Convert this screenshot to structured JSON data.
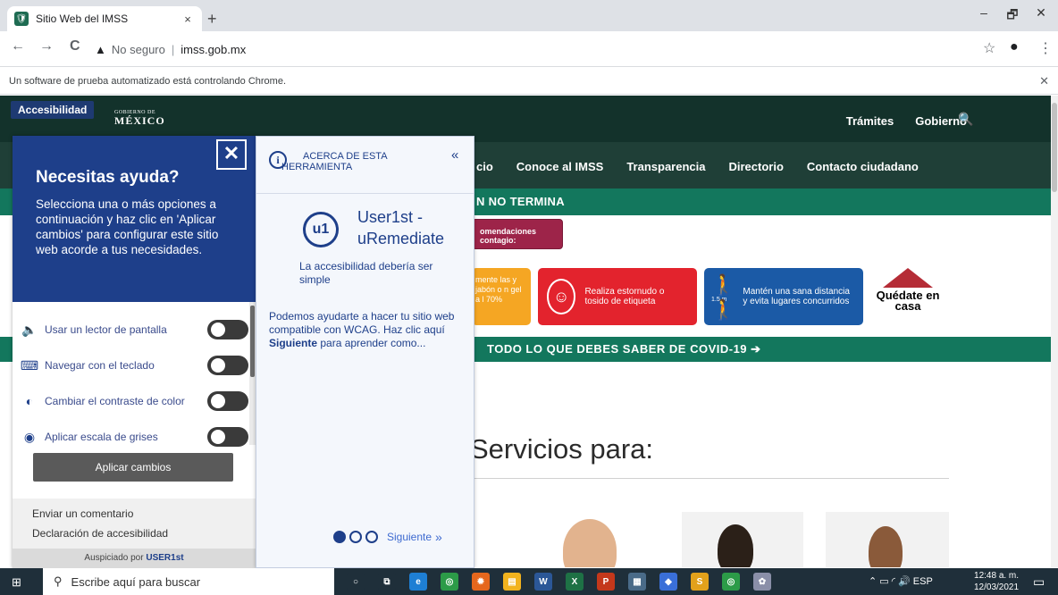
{
  "browser": {
    "tab_title": "Sitio Web del IMSS",
    "tab_close": "×",
    "new_tab": "+",
    "window_min": "–",
    "window_restore": "🗗",
    "window_close": "✕",
    "back": "←",
    "forward": "→",
    "reload": "C",
    "security_icon": "▲",
    "security_label": "No seguro",
    "url_sep": "|",
    "url": "imss.gob.mx",
    "star": "☆",
    "profile": "●",
    "menu": "⋮",
    "infobar_text": "Un software de prueba automatizado está controlando Chrome.",
    "infobar_close": "✕"
  },
  "site": {
    "accessibility_button": "Accesibilidad",
    "gov_logo_small": "GOBIERNO DE",
    "gov_logo_big": "MÉXICO",
    "gov_nav": [
      "Trámites",
      "Gobierno"
    ],
    "search_icon": "🔍",
    "imss_nav": [
      "cio",
      "Conoce al IMSS",
      "Transparencia",
      "Directorio",
      "Contacto ciudadano"
    ],
    "green_strip_text": "N NO TERMINA",
    "reco_text": "omendaciones contagio:",
    "card_orange_text": "mente las y jabón o n gel a l 70%",
    "card_red_text": "Realiza estornudo o tosido de etiqueta",
    "card_blue_text": "Mantén una sana distancia y evita lugares concurridos",
    "card_blue_distance": "1.5 m",
    "home_label": "Quédate en casa",
    "covid_strip_text": "TODO LO QUE DEBES SABER DE COVID-19",
    "covid_icon": "➔",
    "servicios_title": "Servicios para:"
  },
  "accessibility_panel": {
    "close": "✕",
    "title": "Necesitas ayuda?",
    "description": "Selecciona una o más opciones a continuación y haz clic en 'Aplicar cambios' para configurar este sitio web acorde a tus necesidades.",
    "options": [
      {
        "label": "Usar un lector de pantalla",
        "icon": "speaker-icon",
        "glyph": "🔈"
      },
      {
        "label": "Navegar con el teclado",
        "icon": "keyboard-icon",
        "glyph": "⌨"
      },
      {
        "label": "Cambiar el contraste de color",
        "icon": "contrast-icon",
        "glyph": "◐"
      },
      {
        "label": "Aplicar escala de grises",
        "icon": "grayscale-icon",
        "glyph": "◉"
      }
    ],
    "apply_label": "Aplicar cambios",
    "feedback_link": "Enviar un comentario",
    "statement_link": "Declaración de accesibilidad",
    "sponsor_prefix": "Auspiciado por",
    "sponsor_brand": "USER1st"
  },
  "about_panel": {
    "info_glyph": "i",
    "title": "ACERCA DE ESTA HERRAMIENTA",
    "collapse_glyph": "«",
    "logo_text": "u1",
    "brand_line1": "User1st -",
    "brand_line2": "uRemediate",
    "tagline": "La accesibilidad debería ser simple",
    "body_before": "Podemos ayudarte a hacer tu sitio web compatible con WCAG. Haz clic aquí ",
    "body_link": "Siguiente",
    "body_after": " para aprender como...",
    "next_label": "Siguiente",
    "next_glyph": "»"
  },
  "taskbar": {
    "start_glyph": "⊞",
    "search_placeholder": "Escribe aquí para buscar",
    "search_glyph": "⚲",
    "apps": [
      {
        "name": "cortana-icon",
        "glyph": "○",
        "color": "#1f2f3a"
      },
      {
        "name": "task-view-icon",
        "glyph": "⧉",
        "color": "#1f2f3a"
      },
      {
        "name": "edge-icon",
        "glyph": "e",
        "color": "#1e7fd4"
      },
      {
        "name": "chrome-icon",
        "glyph": "◎",
        "color": "#2c9b48"
      },
      {
        "name": "firefox-icon",
        "glyph": "✹",
        "color": "#e5671d"
      },
      {
        "name": "explorer-icon",
        "glyph": "▤",
        "color": "#f2b31e"
      },
      {
        "name": "word-icon",
        "glyph": "W",
        "color": "#2b5797"
      },
      {
        "name": "excel-icon",
        "glyph": "X",
        "color": "#1e7145"
      },
      {
        "name": "powerpoint-icon",
        "glyph": "P",
        "color": "#c4381b"
      },
      {
        "name": "calculator-icon",
        "glyph": "▦",
        "color": "#4a6b88"
      },
      {
        "name": "app-icon",
        "glyph": "◆",
        "color": "#3a6fd8"
      },
      {
        "name": "sublime-icon",
        "glyph": "S",
        "color": "#e2a11b"
      },
      {
        "name": "chrome-active-icon",
        "glyph": "◎",
        "color": "#2c9b48"
      },
      {
        "name": "paint-icon",
        "glyph": "✿",
        "color": "#8a8fa8"
      }
    ],
    "tray": "⌃  ▭  ◜  🔊  ESP",
    "time": "12:48 a. m.",
    "date": "12/03/2021",
    "notification_glyph": "▭"
  }
}
